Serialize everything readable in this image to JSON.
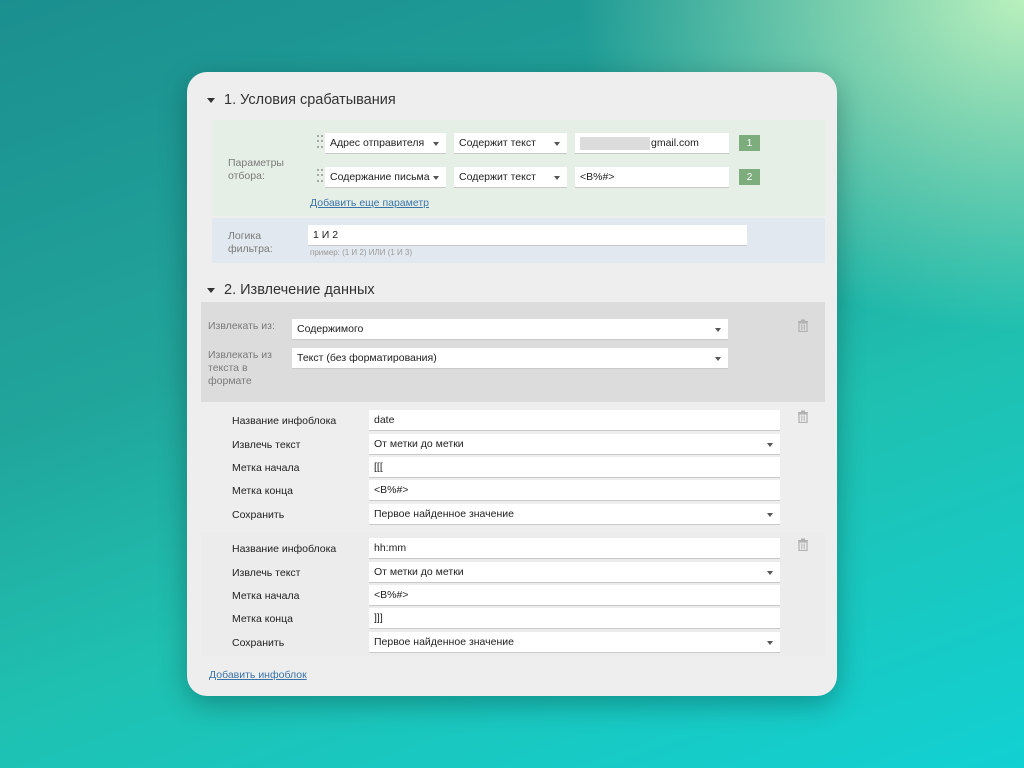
{
  "section1": {
    "title": "1. Условия срабатывания",
    "filter_label": "Параметры отбора:",
    "rows": [
      {
        "field": "Адрес отправителя",
        "operator": "Содержит текст",
        "value": "gmail.com",
        "number": "1"
      },
      {
        "field": "Содержание письма",
        "operator": "Содержит текст",
        "value": "<B%#>",
        "number": "2"
      }
    ],
    "add_param": "Добавить еще параметр",
    "logic_label": "Логика фильтра:",
    "logic_value": "1 И 2",
    "logic_hint": "пример: (1 И 2) ИЛИ (1 И 3)"
  },
  "section2": {
    "title": "2. Извлечение данных",
    "extract_from_label": "Извлекать из:",
    "extract_from_value": "Содержимого",
    "extract_format_label": "Извлекать из текста в формате",
    "extract_format_value": "Текст (без форматирования)",
    "blocks": [
      {
        "name_label": "Название инфоблока",
        "name_value": "date",
        "extract_label": "Извлечь текст",
        "extract_value": "От метки до метки",
        "start_label": "Метка начала",
        "start_value": "[[[",
        "end_label": "Метка конца",
        "end_value": "<B%#>",
        "save_label": "Сохранить",
        "save_value": "Первое найденное значение"
      },
      {
        "name_label": "Название инфоблока",
        "name_value": "hh:mm",
        "extract_label": "Извлечь текст",
        "extract_value": "От метки до метки",
        "start_label": "Метка начала",
        "start_value": "<B%#>",
        "end_label": "Метка конца",
        "end_value": "]]]",
        "save_label": "Сохранить",
        "save_value": "Первое найденное значение"
      }
    ],
    "add_block": "Добавить инфоблок"
  },
  "icons": {
    "section_toggle": "caret-down-icon",
    "drag": "drag-handle-icon",
    "delete": "trash-icon"
  },
  "colors": {
    "filter_bg": "#e6efe6",
    "logic_bg": "#e2e8ef",
    "badge": "#7dac7d",
    "link": "#3a73a8"
  }
}
